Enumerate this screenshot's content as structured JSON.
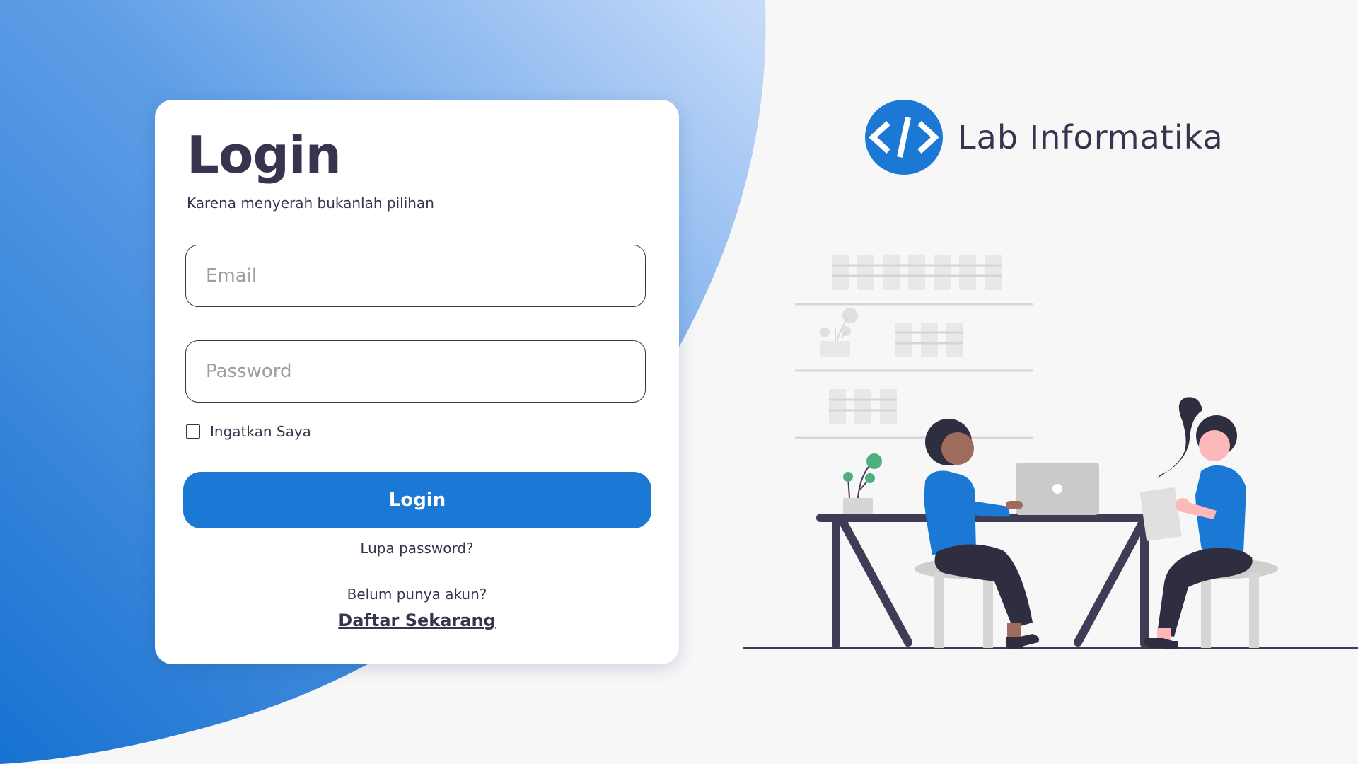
{
  "login_card": {
    "title": "Login",
    "subtitle": "Karena menyerah bukanlah pilihan",
    "email_placeholder": "Email",
    "password_placeholder": "Password",
    "remember_label": "Ingatkan Saya",
    "remember_checked": false,
    "login_button": "Login",
    "forgot_link": "Lupa password?",
    "no_account_text": "Belum punya akun?",
    "register_link": "Daftar Sekarang"
  },
  "brand": {
    "name": "Lab Informatika",
    "logo_icon": "code-brackets-icon"
  },
  "illustration": {
    "name": "people-working-at-table-illustration"
  },
  "colors": {
    "accent": "#1b78d4",
    "text": "#38344f",
    "background": "#f7f7f7",
    "card": "#ffffff"
  }
}
